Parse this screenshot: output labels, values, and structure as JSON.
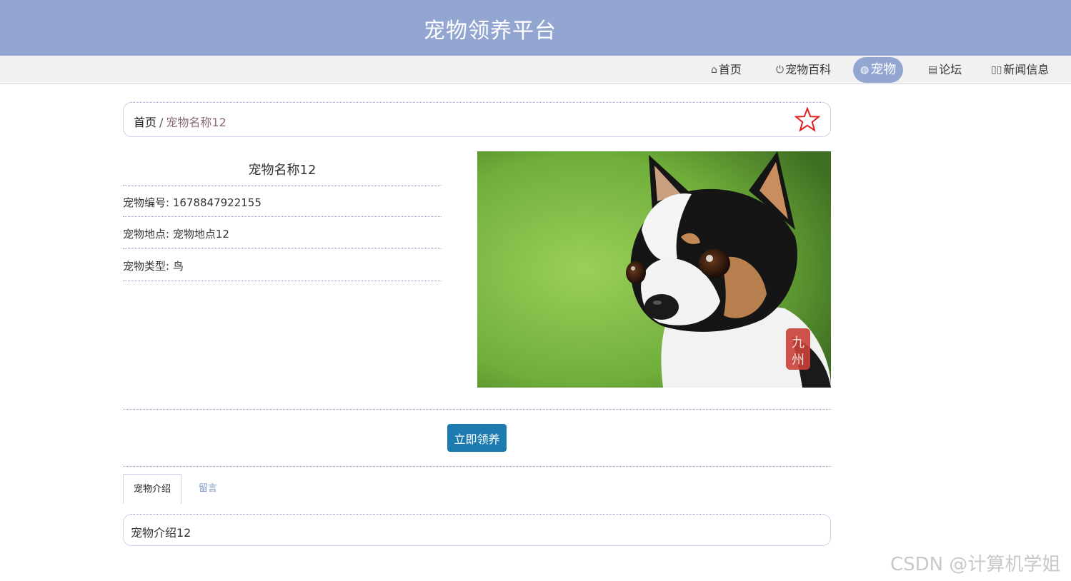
{
  "header": {
    "title": "宠物领养平台"
  },
  "nav": {
    "items": [
      {
        "label": "首页",
        "icon": "home-icon"
      },
      {
        "label": "宠物百科",
        "icon": "power-icon"
      },
      {
        "label": "宠物",
        "icon": "globe-icon",
        "active": true
      },
      {
        "label": "论坛",
        "icon": "newspaper-icon"
      },
      {
        "label": "新闻信息",
        "icon": "columns-icon"
      }
    ]
  },
  "breadcrumb": {
    "home": "首页",
    "separator": "/",
    "current": "宠物名称12"
  },
  "pet": {
    "name": "宠物名称12",
    "number": "宠物编号: 1678847922155",
    "location": "宠物地点: 宠物地点12",
    "type": "宠物类型: 鸟"
  },
  "actions": {
    "adopt": "立即领养"
  },
  "tabs": [
    {
      "label": "宠物介绍",
      "active": true
    },
    {
      "label": "留言",
      "active": false
    }
  ],
  "tab_content": "宠物介绍12",
  "watermark": "CSDN @计算机学姐",
  "colors": {
    "header": "#93a6d2",
    "button": "#1e7bb0",
    "star": "#e02020"
  }
}
